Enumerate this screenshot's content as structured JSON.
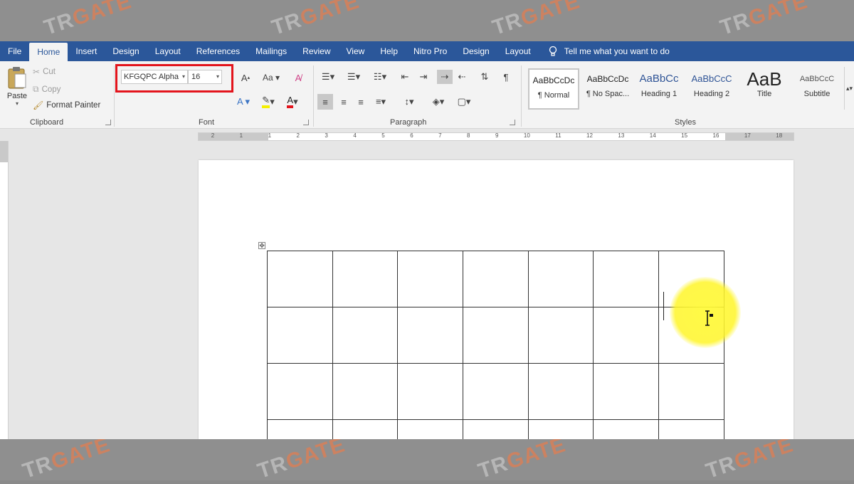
{
  "watermark": {
    "prefix": "TR",
    "brand": "GATE"
  },
  "tabs": [
    "File",
    "Home",
    "Insert",
    "Design",
    "Layout",
    "References",
    "Mailings",
    "Review",
    "View",
    "Help",
    "Nitro Pro",
    "Design",
    "Layout"
  ],
  "active_tab": "Home",
  "tell_me": "Tell me what you want to do",
  "clipboard": {
    "paste": "Paste",
    "cut": "Cut",
    "copy": "Copy",
    "format_painter": "Format Painter",
    "label": "Clipboard"
  },
  "font": {
    "name": "KFGQPC Alpha",
    "size": "16",
    "label": "Font"
  },
  "paragraph": {
    "label": "Paragraph"
  },
  "styles": {
    "label": "Styles",
    "items": [
      {
        "preview": "AaBbCcDc",
        "name": "¶ Normal"
      },
      {
        "preview": "AaBbCcDc",
        "name": "¶ No Spac..."
      },
      {
        "preview": "AaBbCc",
        "name": "Heading 1"
      },
      {
        "preview": "AaBbCcC",
        "name": "Heading 2"
      },
      {
        "preview": "AaB",
        "name": "Title"
      },
      {
        "preview": "AaBbCcC",
        "name": "Subtitle"
      }
    ]
  },
  "ruler": [
    "2",
    "1",
    "1",
    "2",
    "3",
    "4",
    "5",
    "6",
    "7",
    "8",
    "9",
    "10",
    "11",
    "12",
    "13",
    "14",
    "15",
    "16",
    "17",
    "18"
  ],
  "table": {
    "rows": 4,
    "cols": 7
  },
  "colors": {
    "tab_bar": "#2b579a",
    "highlight": "#e3141c",
    "cursor_glow": "#fff83c"
  }
}
